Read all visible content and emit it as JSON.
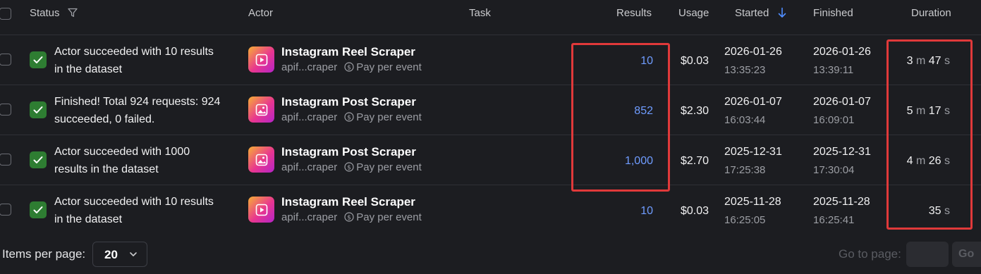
{
  "header": {
    "status": "Status",
    "actor": "Actor",
    "task": "Task",
    "results": "Results",
    "usage": "Usage",
    "started": "Started",
    "finished": "Finished",
    "duration": "Duration"
  },
  "rows": [
    {
      "status_line1": "Actor succeeded with 10 results",
      "status_line2": "in the dataset",
      "actor_name": "Instagram Reel Scraper",
      "actor_icon": "video-play-icon",
      "actor_id": "apif...craper",
      "pricing": "Pay per event",
      "results": "10",
      "usage": "$0.03",
      "started_date": "2026-01-26",
      "started_time": "13:35:23",
      "finished_date": "2026-01-26",
      "finished_time": "13:39:11",
      "dur_min": "3",
      "dur_min_unit": "m",
      "dur_sec": "47",
      "dur_sec_unit": "s"
    },
    {
      "status_line1": "Finished! Total 924 requests: 924",
      "status_line2": "succeeded, 0 failed.",
      "actor_name": "Instagram Post Scraper",
      "actor_icon": "image-icon",
      "actor_id": "apif...craper",
      "pricing": "Pay per event",
      "results": "852",
      "usage": "$2.30",
      "started_date": "2026-01-07",
      "started_time": "16:03:44",
      "finished_date": "2026-01-07",
      "finished_time": "16:09:01",
      "dur_min": "5",
      "dur_min_unit": "m",
      "dur_sec": "17",
      "dur_sec_unit": "s"
    },
    {
      "status_line1": "Actor succeeded with 1000",
      "status_line2": "results in the dataset",
      "actor_name": "Instagram Post Scraper",
      "actor_icon": "image-icon",
      "actor_id": "apif...craper",
      "pricing": "Pay per event",
      "results": "1,000",
      "usage": "$2.70",
      "started_date": "2025-12-31",
      "started_time": "17:25:38",
      "finished_date": "2025-12-31",
      "finished_time": "17:30:04",
      "dur_min": "4",
      "dur_min_unit": "m",
      "dur_sec": "26",
      "dur_sec_unit": "s"
    },
    {
      "status_line1": "Actor succeeded with 10 results",
      "status_line2": "in the dataset",
      "actor_name": "Instagram Reel Scraper",
      "actor_icon": "video-play-icon",
      "actor_id": "apif...craper",
      "pricing": "Pay per event",
      "results": "10",
      "usage": "$0.03",
      "started_date": "2025-11-28",
      "started_time": "16:25:05",
      "finished_date": "2025-11-28",
      "finished_time": "16:25:41",
      "dur_min": "",
      "dur_min_unit": "",
      "dur_sec": "35",
      "dur_sec_unit": "s"
    }
  ],
  "footer": {
    "items_per_page_label": "Items per page:",
    "items_per_page_value": "20",
    "goto_label": "Go to page:",
    "go_button": "Go"
  },
  "colors": {
    "background": "#1c1d21",
    "link": "#6f9cff",
    "success": "#2e7d32",
    "highlight": "#e0393a"
  }
}
